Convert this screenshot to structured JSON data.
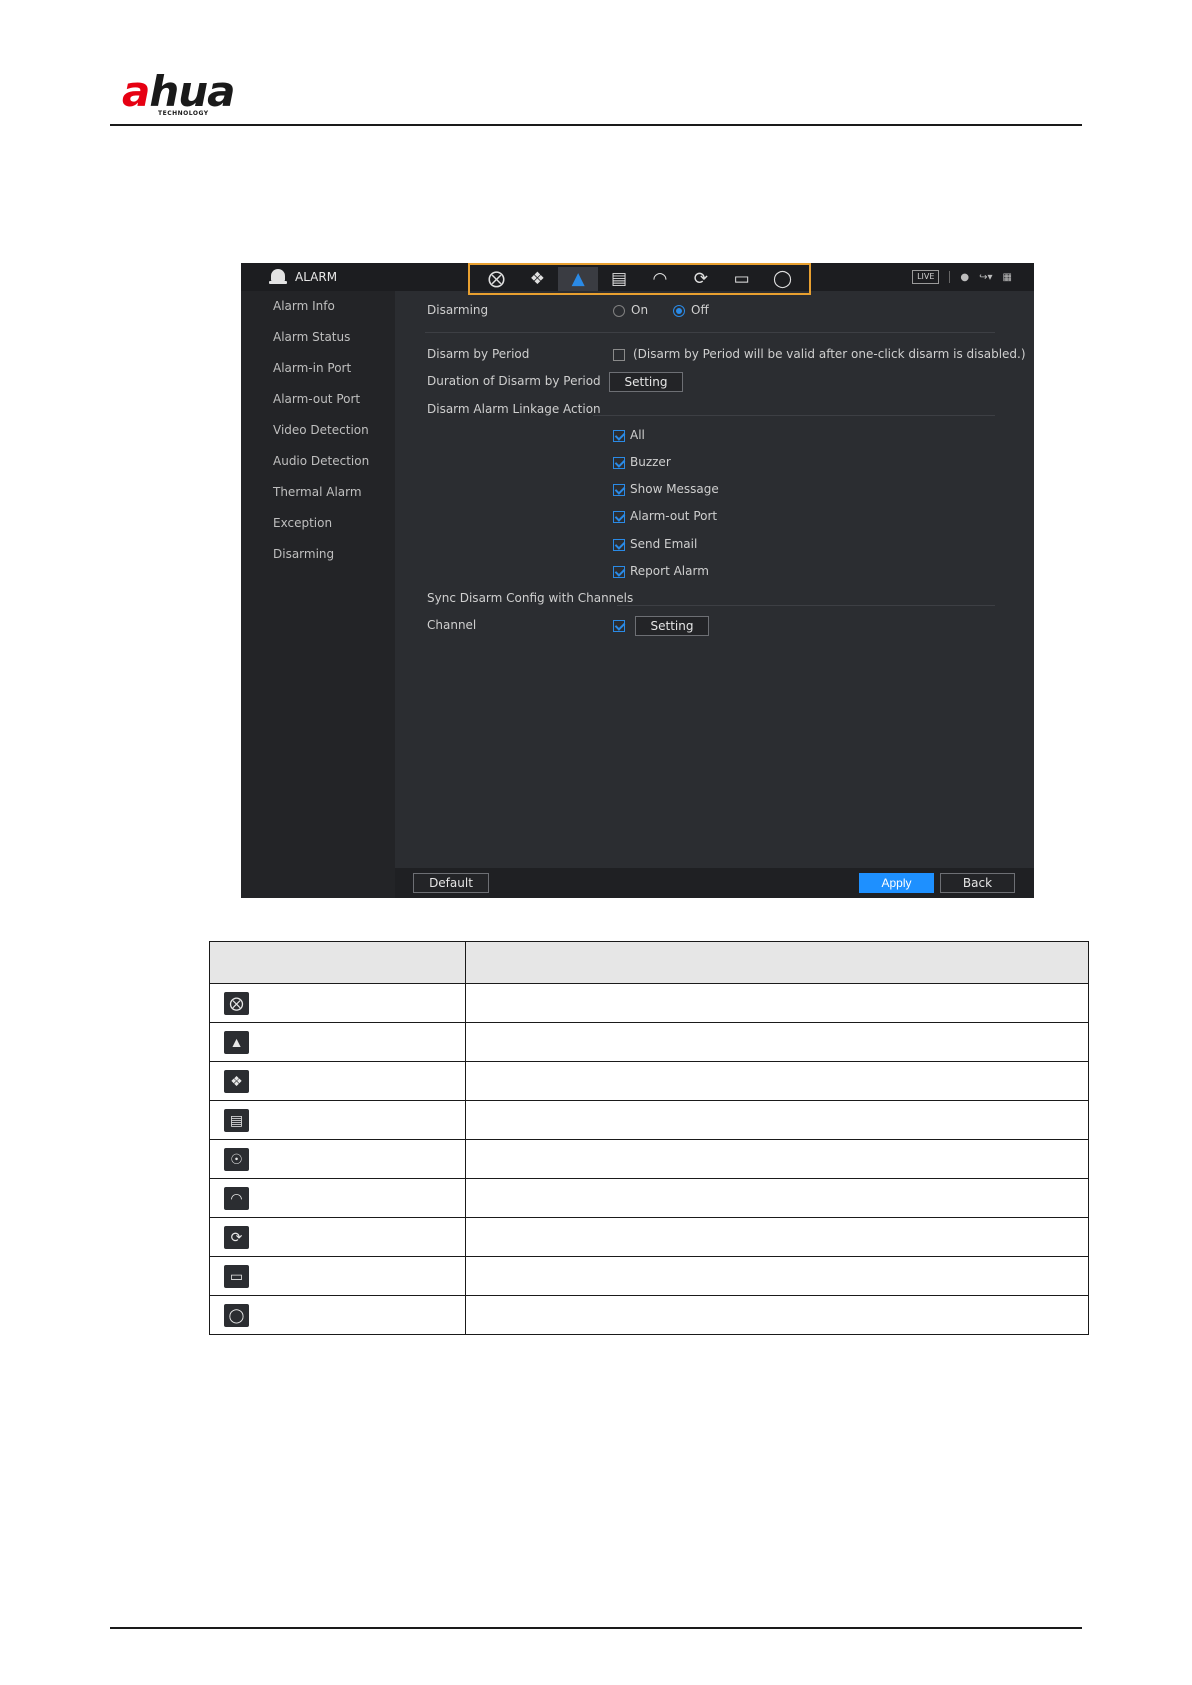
{
  "logo": {
    "brand_a": "a",
    "brand_rest": "hua",
    "tagline": "TECHNOLOGY"
  },
  "screen": {
    "topbar": {
      "title": "ALARM",
      "icons": [
        "search-icon",
        "intelligence-icon",
        "alarm-icon",
        "storage-icon",
        "operation-icon",
        "backup-icon",
        "display-icon",
        "audio-icon"
      ],
      "active_icon": "alarm-icon",
      "live_label": "LIVE"
    },
    "sidebar": {
      "items": [
        {
          "label": "Alarm Info"
        },
        {
          "label": "Alarm Status"
        },
        {
          "label": "Alarm-in Port"
        },
        {
          "label": "Alarm-out Port"
        },
        {
          "label": "Video Detection"
        },
        {
          "label": "Audio Detection"
        },
        {
          "label": "Thermal Alarm"
        },
        {
          "label": "Exception"
        },
        {
          "label": "Disarming"
        }
      ]
    },
    "content": {
      "disarming_label": "Disarming",
      "on_label": "On",
      "off_label": "Off",
      "disarming_value": "Off",
      "disarm_by_period_label": "Disarm by Period",
      "disarm_by_period_checked": false,
      "disarm_by_period_note": "(Disarm by Period will be valid after one-click disarm is disabled.)",
      "duration_label": "Duration of Disarm by Period",
      "setting_label": "Setting",
      "linkage_label": "Disarm Alarm Linkage Action",
      "linkage_options": [
        {
          "label": "All",
          "checked": true
        },
        {
          "label": "Buzzer",
          "checked": true
        },
        {
          "label": "Show Message",
          "checked": true
        },
        {
          "label": "Alarm-out Port",
          "checked": true
        },
        {
          "label": "Send Email",
          "checked": true
        },
        {
          "label": "Report Alarm",
          "checked": true
        }
      ],
      "sync_label": "Sync Disarm Config with Channels",
      "channel_label": "Channel",
      "channel_checked": true,
      "channel_setting_label": "Setting"
    },
    "footer": {
      "default_label": "Default",
      "apply_label": "Apply",
      "back_label": "Back"
    }
  },
  "legend_table": {
    "header": [
      "",
      ""
    ],
    "rows": [
      {
        "icon": "search-icon",
        "description": ""
      },
      {
        "icon": "alarm-icon",
        "description": ""
      },
      {
        "icon": "intelligence-icon",
        "description": ""
      },
      {
        "icon": "storage-icon",
        "description": ""
      },
      {
        "icon": "network-icon",
        "description": ""
      },
      {
        "icon": "operation-icon",
        "description": ""
      },
      {
        "icon": "backup-icon",
        "description": ""
      },
      {
        "icon": "display-icon",
        "description": ""
      },
      {
        "icon": "audio-icon",
        "description": ""
      }
    ]
  }
}
